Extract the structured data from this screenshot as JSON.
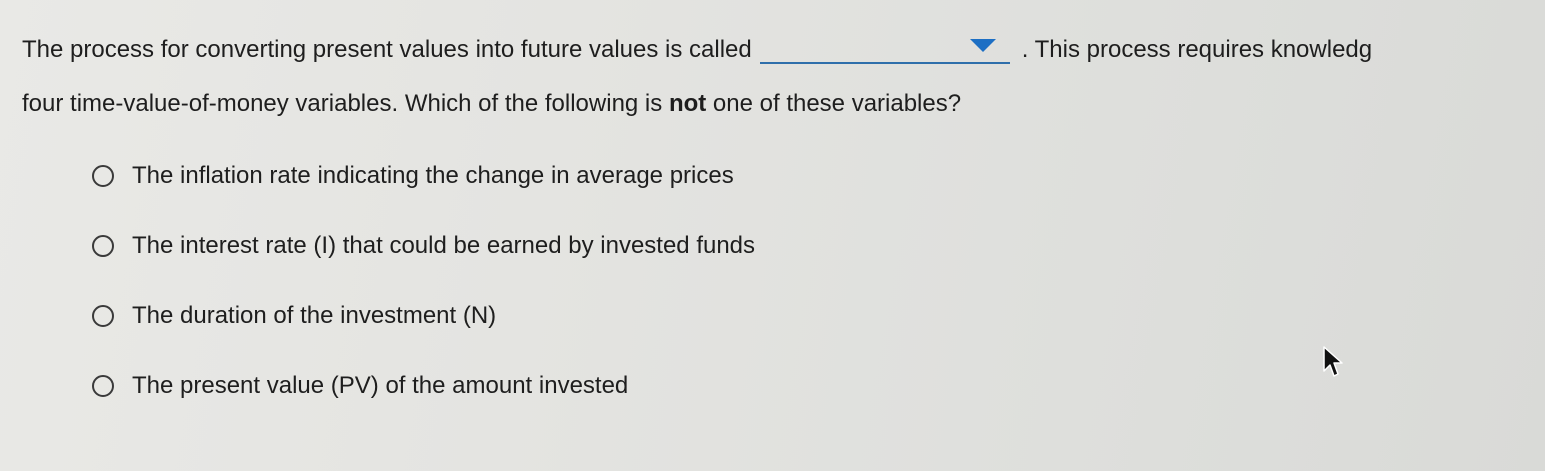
{
  "question": {
    "line1_prefix": "The process for converting present values into future values is called",
    "line1_suffix": ". This process requires knowledg",
    "line2_prefix": "four time-value-of-money variables. Which of the following is ",
    "line2_bold": "not",
    "line2_suffix": " one of these variables?",
    "dropdown_value": ""
  },
  "options": [
    {
      "label": "The inflation rate indicating the change in average prices"
    },
    {
      "label": "The interest rate (I) that could be earned by invested funds"
    },
    {
      "label": "The duration of the investment (N)"
    },
    {
      "label": "The present value (PV) of the amount invested"
    }
  ],
  "colors": {
    "accent": "#1d6fc4",
    "underline": "#2f6fab"
  }
}
